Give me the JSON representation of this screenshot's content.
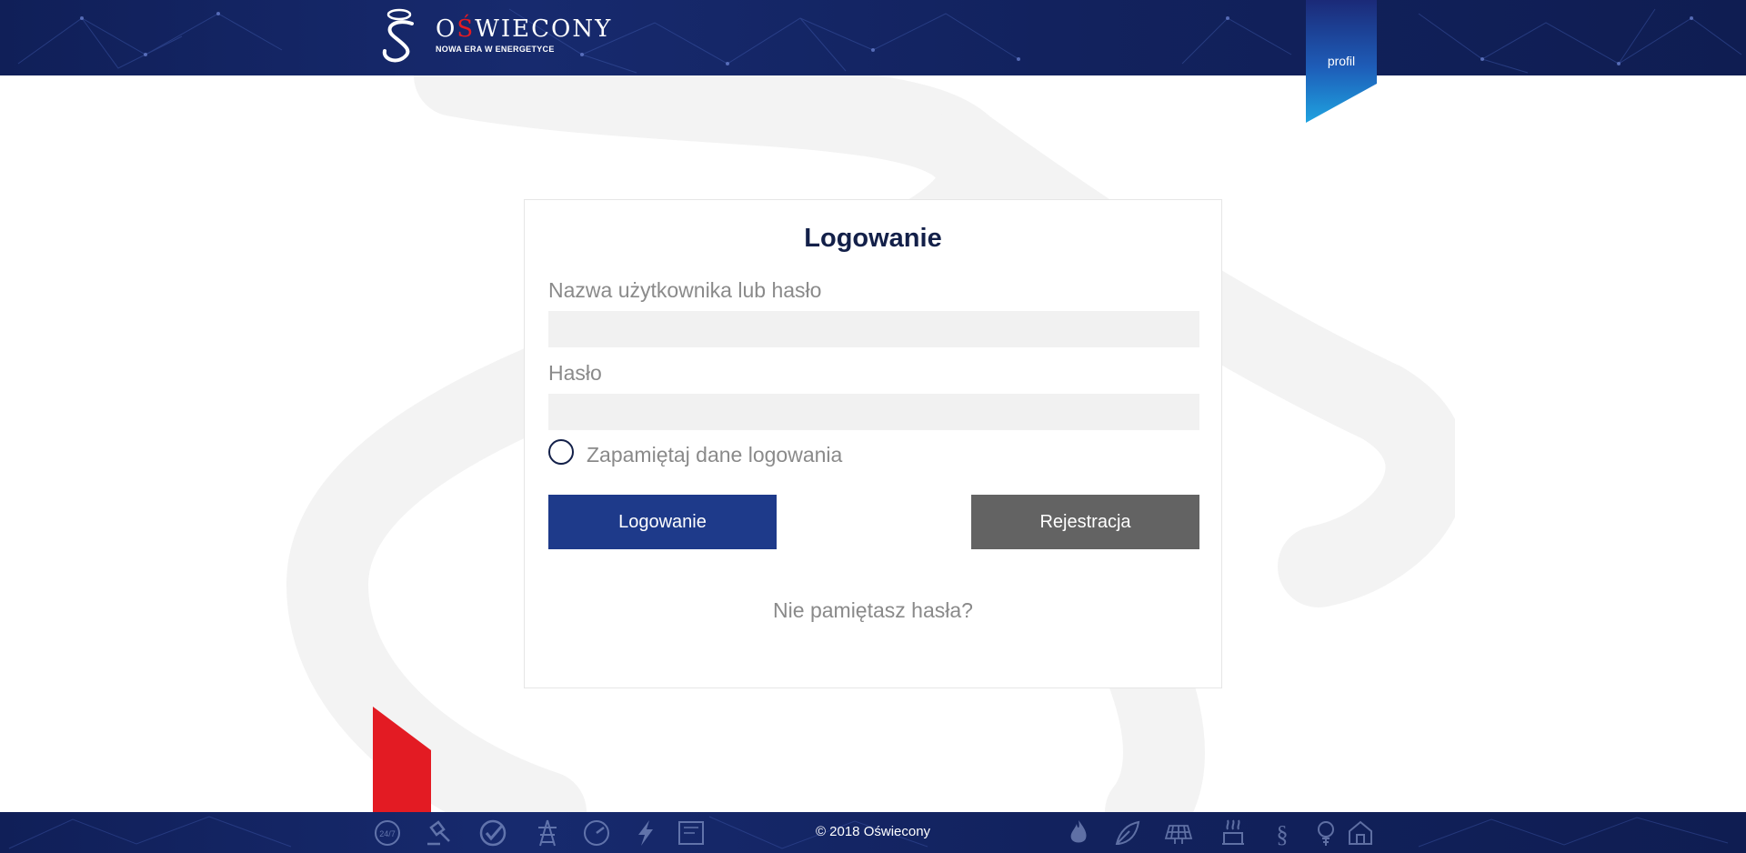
{
  "header": {
    "logo_name_first": "O",
    "logo_name_red": "Ś",
    "logo_name_rest": "WIECONY",
    "logo_tagline": "NOWA ERA W ENERGETYCE",
    "profile_label": "profil"
  },
  "login": {
    "title": "Logowanie",
    "username_label": "Nazwa użytkownika lub hasło",
    "password_label": "Hasło",
    "remember_label": "Zapamiętaj dane logowania",
    "login_button": "Logowanie",
    "register_button": "Rejestracja",
    "forgot_link": "Nie pamiętasz hasła?"
  },
  "footer": {
    "copyright": "© 2018 Oświecony",
    "icons_left": [
      "24-7-icon",
      "gavel-icon",
      "checkmark-icon",
      "power-pylon-icon",
      "meter-dial-icon",
      "lightning-icon",
      "tariff-icon"
    ],
    "icons_right": [
      "flame-icon",
      "leaf-icon",
      "solar-panel-icon",
      "heater-icon",
      "paragraph-icon",
      "bulb-icon",
      "house-icon"
    ]
  },
  "colors": {
    "header_bg": "#13235f",
    "accent_blue": "#1e3a8a",
    "register_gray": "#636363",
    "brand_red": "#e31b23",
    "ribbon_top": "#1b2a78",
    "ribbon_bottom": "#1fa3e0"
  }
}
